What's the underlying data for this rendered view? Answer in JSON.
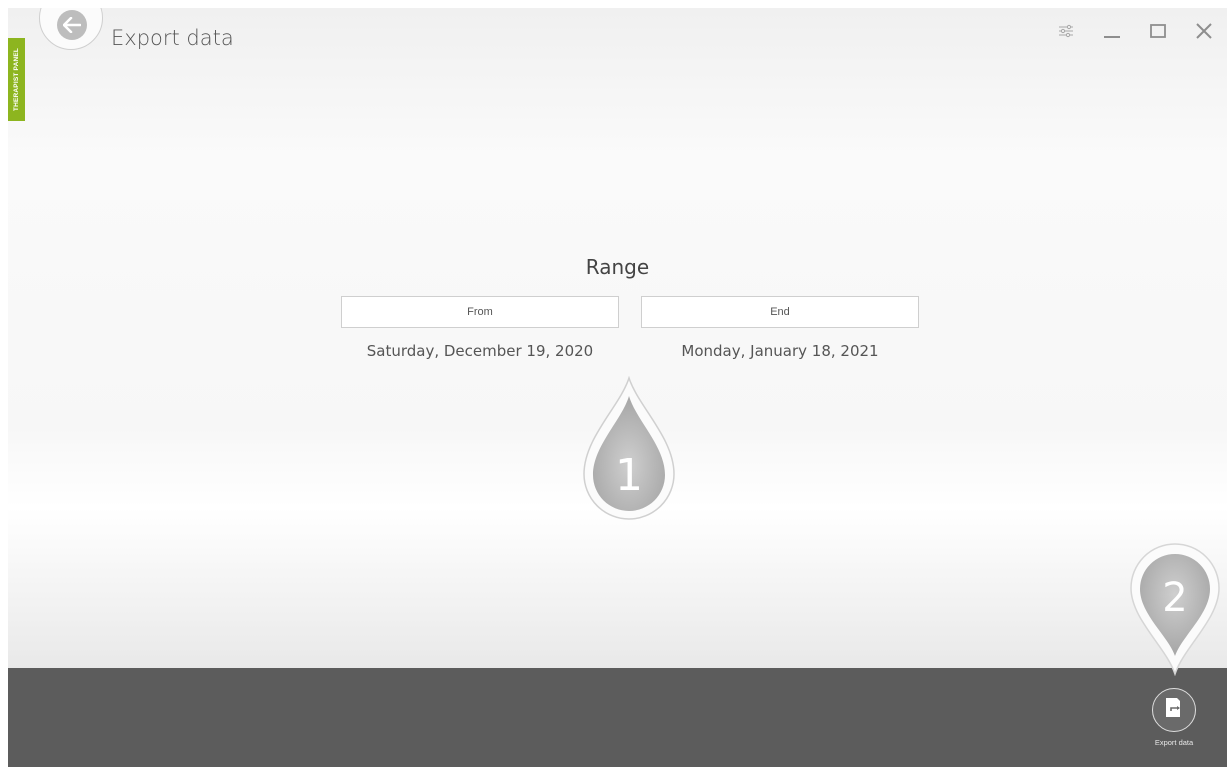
{
  "side_tab": {
    "label": "THERAPIST PANEL"
  },
  "header": {
    "title": "Export data",
    "back_icon": "arrow-left-icon",
    "controls": [
      {
        "name": "settings",
        "icon": "sliders-icon"
      },
      {
        "name": "minimize",
        "icon": "minimize-icon"
      },
      {
        "name": "maximize",
        "icon": "maximize-icon"
      },
      {
        "name": "close",
        "icon": "close-icon"
      }
    ]
  },
  "range": {
    "title": "Range",
    "from_label": "From",
    "from_date": "Saturday, December 19, 2020",
    "end_label": "End",
    "end_date": "Monday, January 18, 2021"
  },
  "markers": [
    {
      "number": "1"
    },
    {
      "number": "2"
    }
  ],
  "footer": {
    "export_label": "Export data",
    "export_icon": "export-document-icon"
  },
  "colors": {
    "accent": "#8db51f",
    "footer_bg": "#5c5c5c"
  }
}
